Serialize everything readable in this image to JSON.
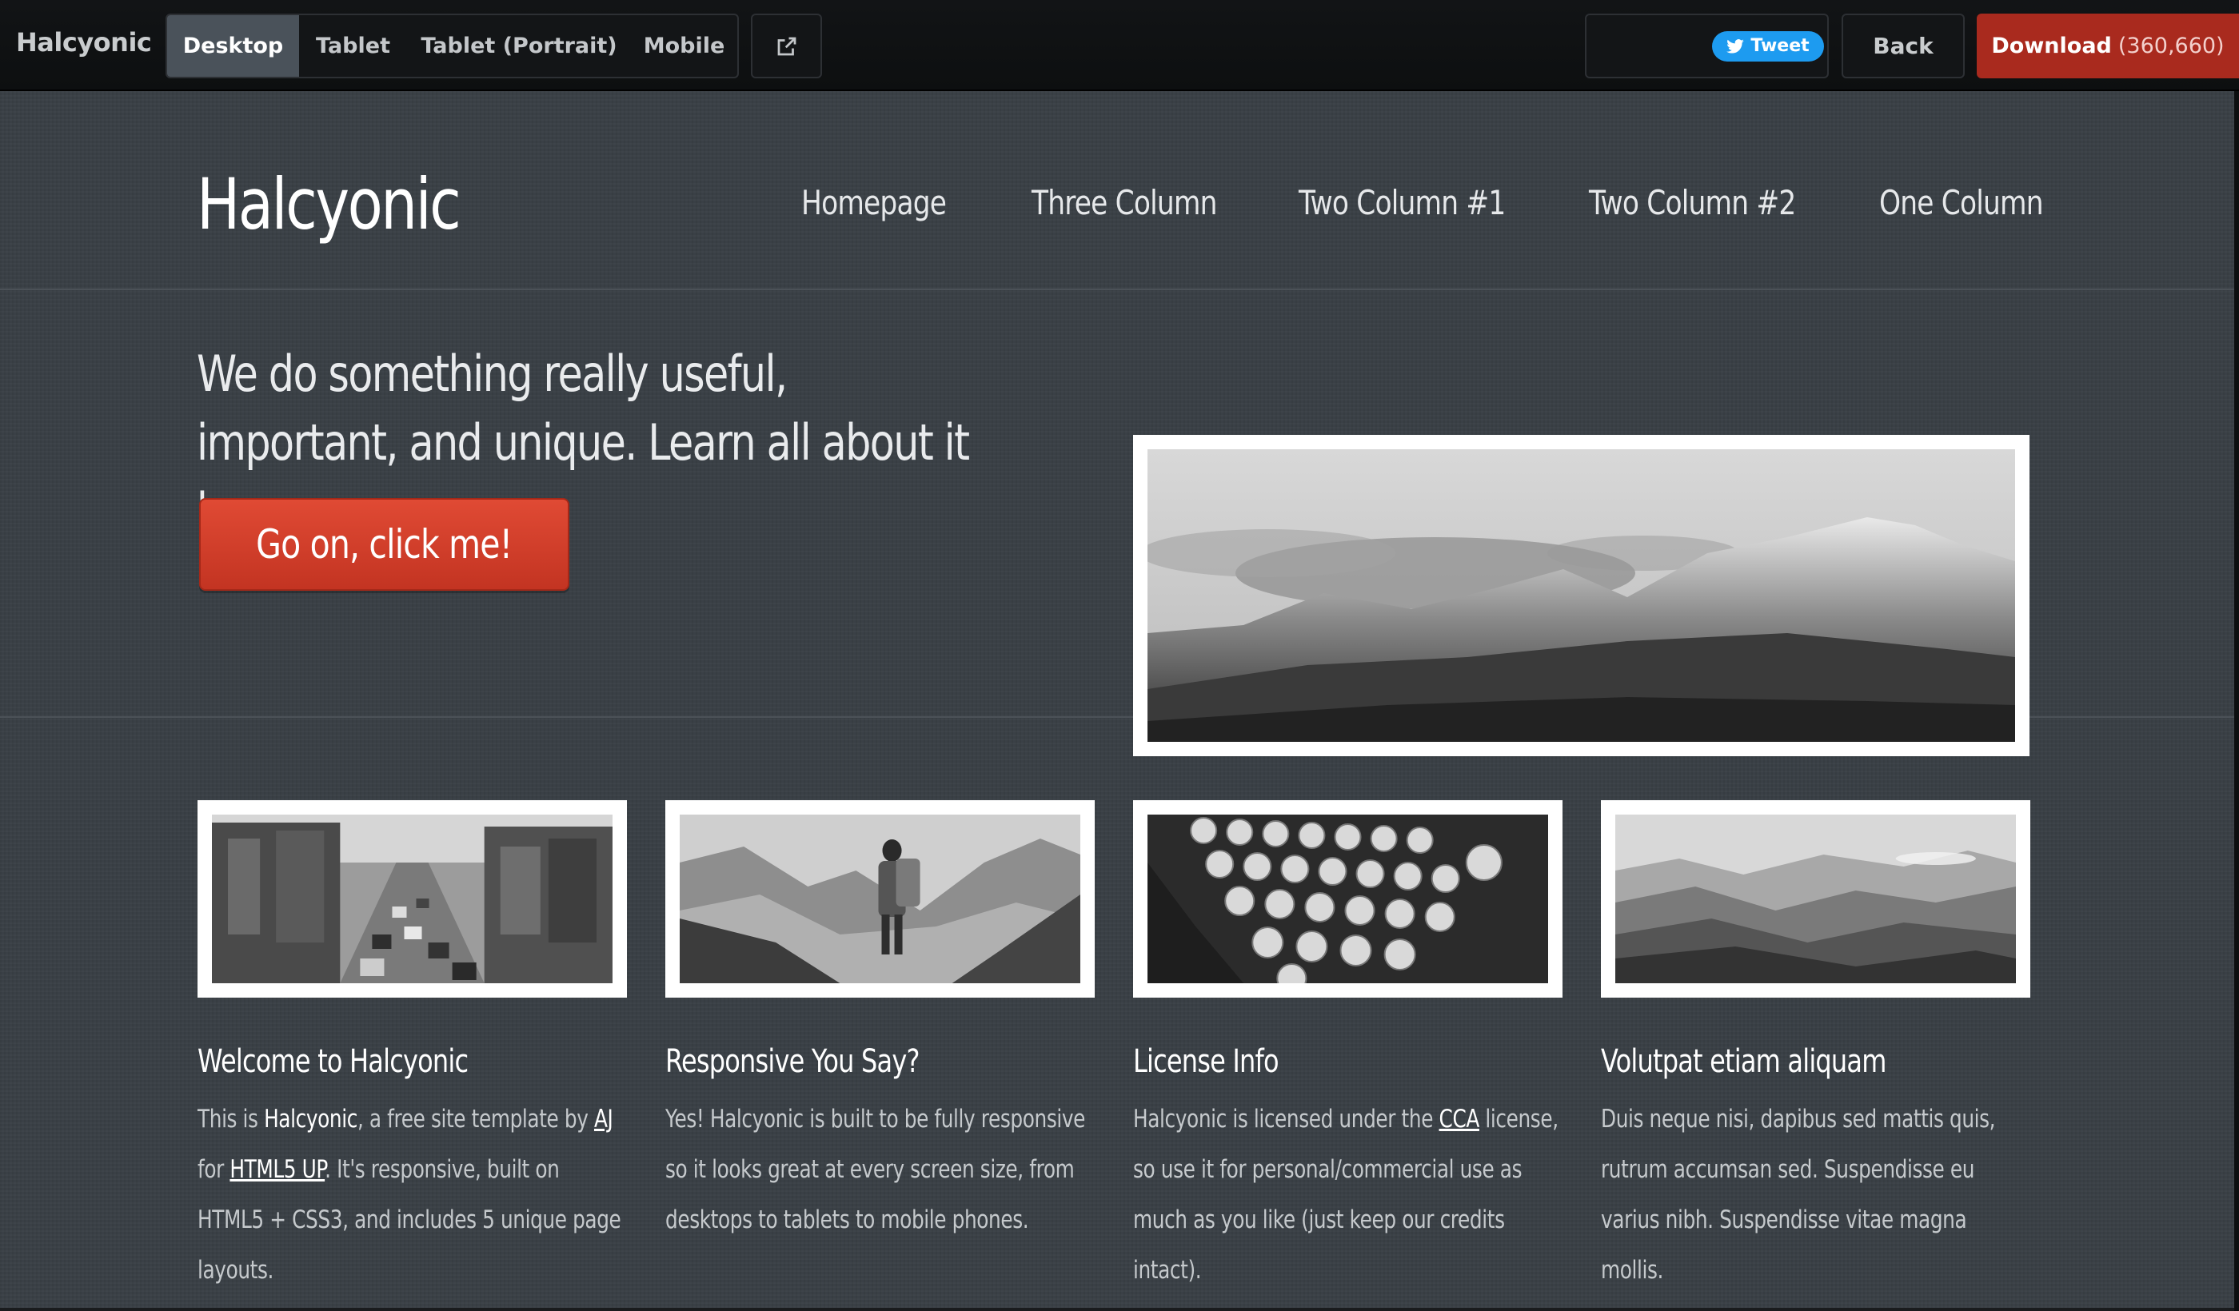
{
  "topbar": {
    "brand": "Halcyonic",
    "devices": [
      {
        "label": "Desktop",
        "active": true
      },
      {
        "label": "Tablet",
        "active": false
      },
      {
        "label": "Tablet (Portrait)",
        "active": false
      },
      {
        "label": "Mobile",
        "active": false
      }
    ],
    "external_icon": "external-link-icon",
    "tweet_label": "Tweet",
    "back_label": "Back",
    "download_label": "Download",
    "download_count": "(360,660)"
  },
  "site": {
    "logo": "Halcyonic",
    "nav": [
      "Homepage",
      "Three Column",
      "Two Column #1",
      "Two Column #2",
      "One Column"
    ],
    "tagline": "We do something really useful, important, and unique. Learn all about it here ...",
    "cta_label": "Go on, click me!",
    "features": [
      {
        "title": "Welcome to Halcyonic",
        "body": [
          {
            "t": "This is "
          },
          {
            "t": "Halcyonic",
            "hl": true
          },
          {
            "t": ", a free site template by "
          },
          {
            "t": "AJ",
            "link": true
          },
          {
            "t": " for "
          },
          {
            "t": "HTML5 UP",
            "link": true
          },
          {
            "t": ". It's responsive, built on HTML5 + CSS3, and includes 5 unique page layouts."
          }
        ]
      },
      {
        "title": "Responsive You Say?",
        "body": [
          {
            "t": "Yes! Halcyonic is built to be fully responsive so it looks great at every screen size, from desktops to tablets to mobile phones."
          }
        ]
      },
      {
        "title": "License Info",
        "body": [
          {
            "t": "Halcyonic is licensed under the "
          },
          {
            "t": "CCA",
            "link": true
          },
          {
            "t": " license, so use it for personal/commercial use as much as you like (just keep our credits intact)."
          }
        ]
      },
      {
        "title": "Volutpat etiam aliquam",
        "body": [
          {
            "t": "Duis neque nisi, dapibus sed mattis quis, rutrum accumsan sed. Suspendisse eu varius nibh. Suspendisse vitae magna mollis."
          }
        ]
      }
    ]
  },
  "colors": {
    "accent": "#a92a1e",
    "cta": "#d23f2b",
    "site_bg": "#3a4046",
    "tweet": "#1d9bf0"
  }
}
